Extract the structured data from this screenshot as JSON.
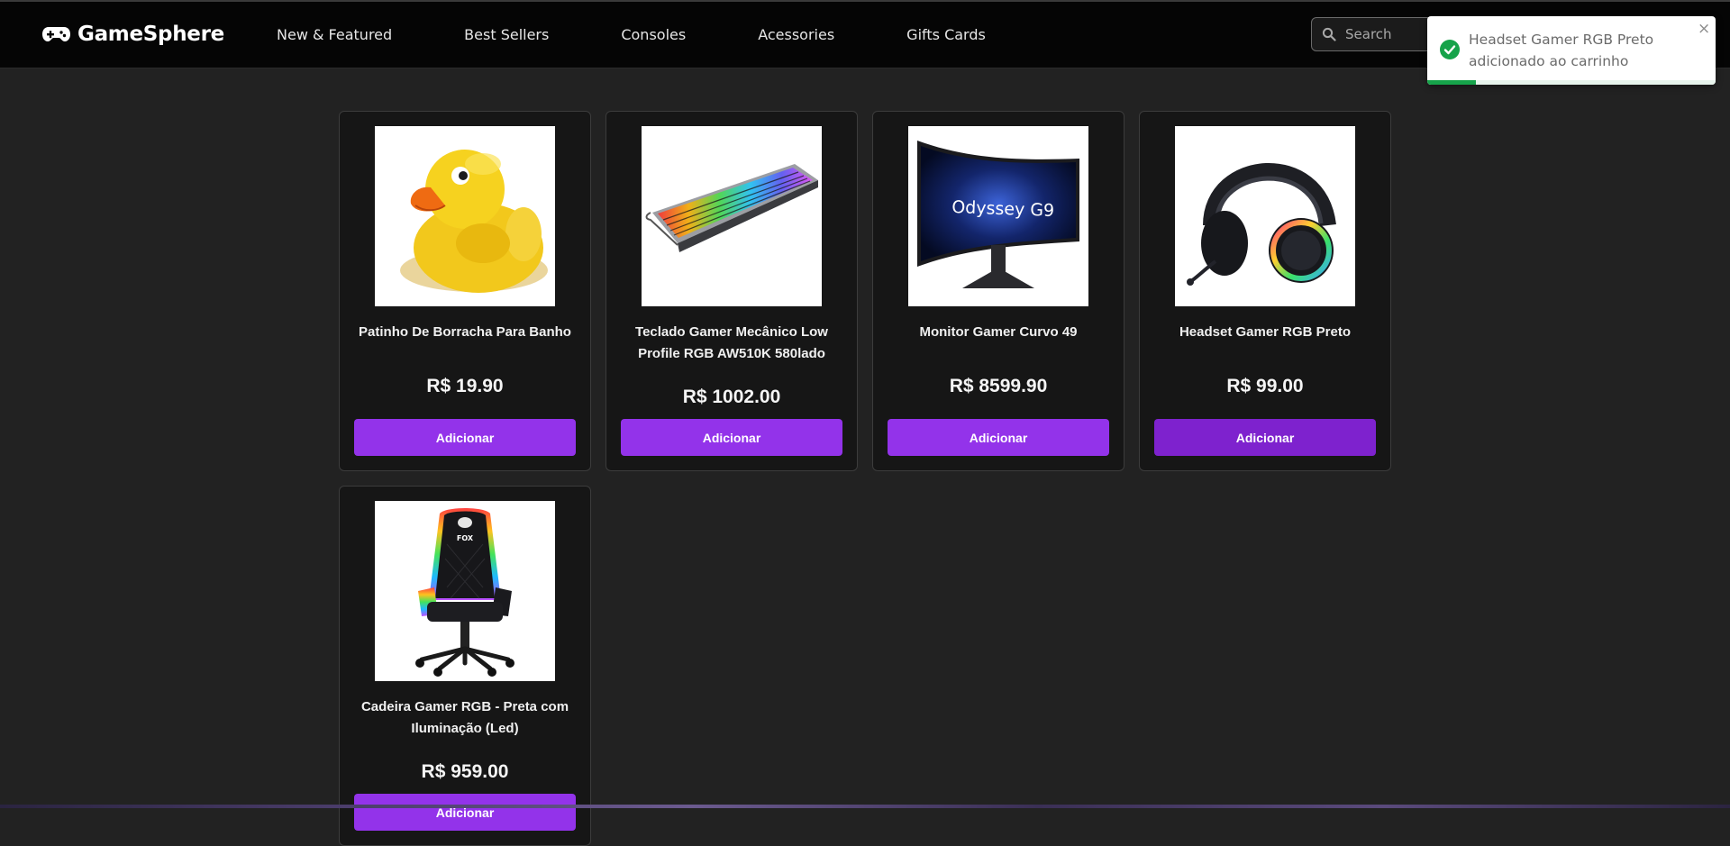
{
  "brand": {
    "name": "GameSphere",
    "icon": "gamepad-icon"
  },
  "nav": {
    "links": [
      "New & Featured",
      "Best Sellers",
      "Consoles",
      "Acessories",
      "Gifts Cards"
    ]
  },
  "search": {
    "placeholder": "Search",
    "value": "",
    "icon": "search-icon"
  },
  "toast": {
    "message": "Headset Gamer RGB Preto adicionado ao carrinho",
    "icon": "check-circle-icon",
    "close": "×",
    "progress": 0.17,
    "color": "#16a34a"
  },
  "products": [
    {
      "name": "Patinho De Borracha Para Banho",
      "price": "R$ 19.90",
      "button": "Adicionar",
      "image": "rubber-duck"
    },
    {
      "name": "Teclado Gamer Mecânico Low Profile RGB AW510K 580lado",
      "price": "R$ 1002.00",
      "button": "Adicionar",
      "image": "keyboard"
    },
    {
      "name": "Monitor Gamer Curvo 49",
      "price": "R$ 8599.90",
      "button": "Adicionar",
      "image": "monitor",
      "screen_text": "Odyssey G9"
    },
    {
      "name": "Headset Gamer RGB Preto",
      "price": "R$ 99.00",
      "button": "Adicionar",
      "image": "headset"
    },
    {
      "name": "Cadeira Gamer RGB - Preta com Iluminação (Led)",
      "price": "R$ 959.00",
      "button": "Adicionar",
      "image": "chair",
      "logo_text": "FOX"
    }
  ],
  "colors": {
    "background": "#222222",
    "navbar": "#050505",
    "card": "#161616",
    "accent": "#9333ea",
    "accent_hover": "#7e22ce"
  }
}
